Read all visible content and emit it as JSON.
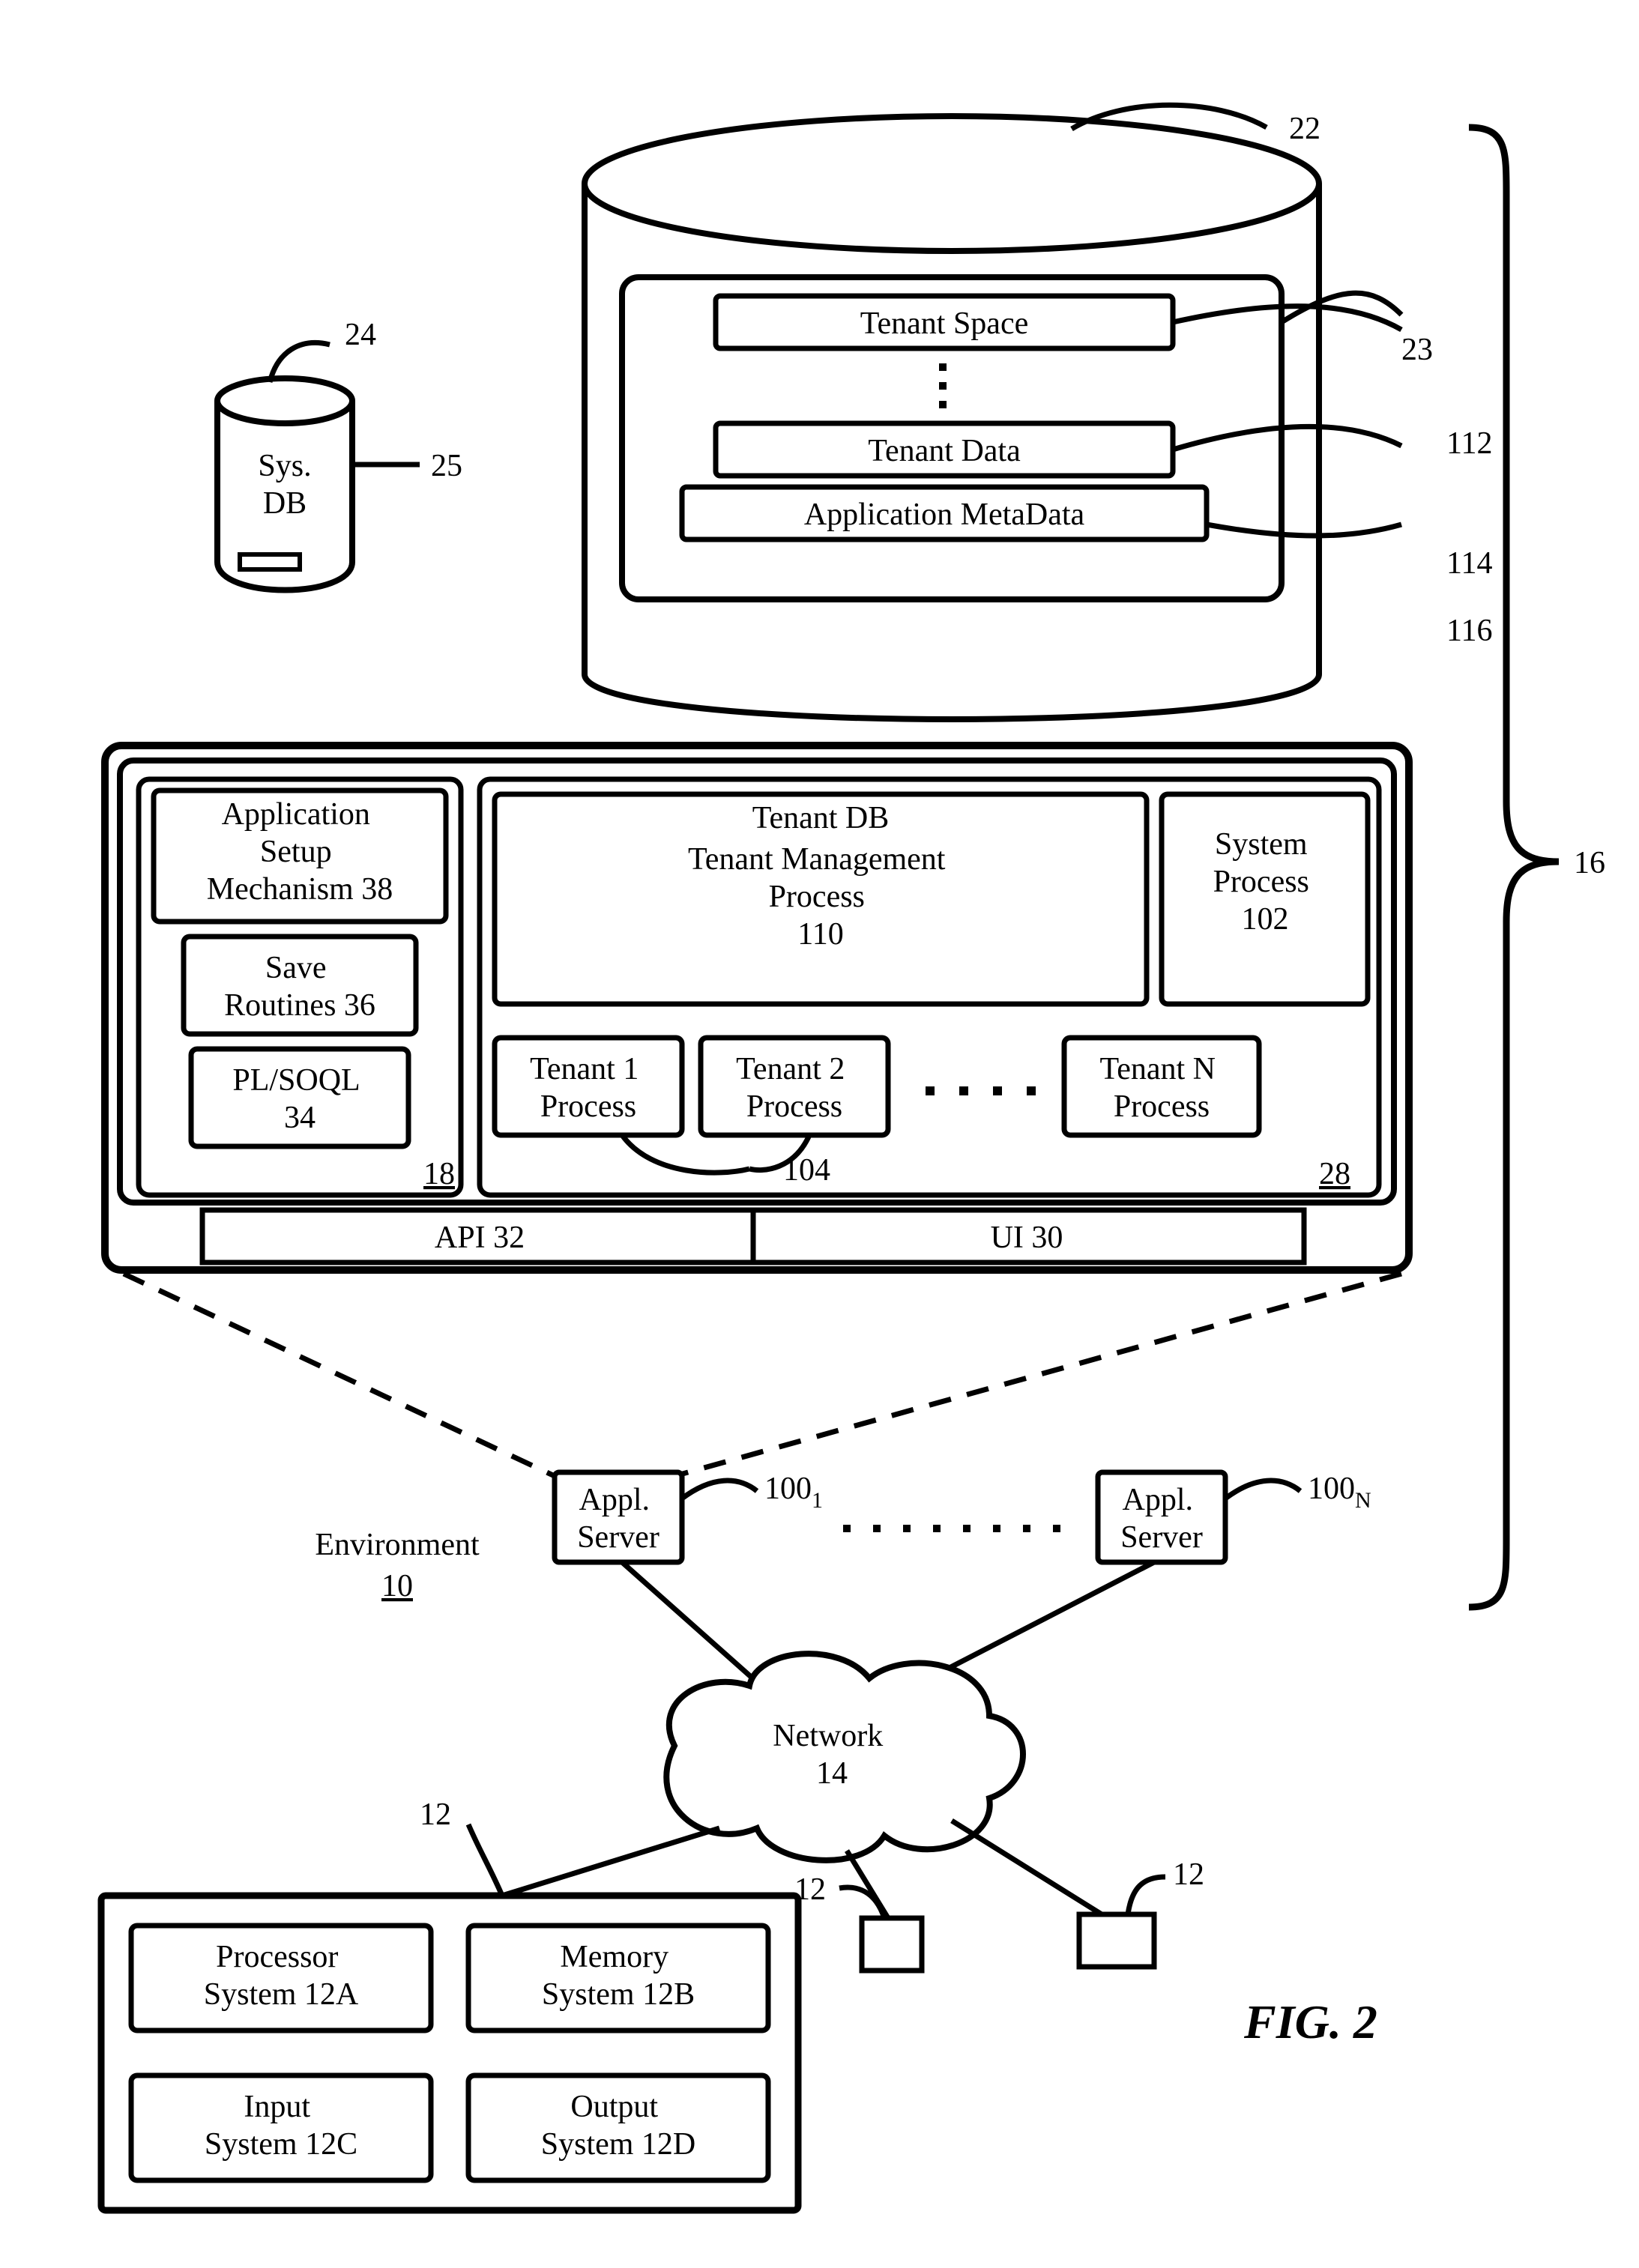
{
  "figure_label": "FIG. 2",
  "tenant_db_outer_ref": "22",
  "sys_db_label": "Sys.\nDB",
  "sys_db_ref_top": "24",
  "sys_db_ref_body": "25",
  "tenant_inner_ref": "23",
  "tenant_space": "Tenant Space",
  "tenant_data": "Tenant Data",
  "app_metadata": "Application MetaData",
  "ref_112": "112",
  "ref_114": "114",
  "ref_116": "116",
  "sys_brace_label": "16",
  "appl_setup": "Application\nSetup\nMechanism 38",
  "save_routines": "Save\nRoutines 36",
  "plsoql": "PL/SOQL\n34",
  "ref_18": "18",
  "tdb_header": "Tenant DB",
  "tmp_text": "Tenant Management\nProcess\n110",
  "sys_proc": "System\nProcess\n102",
  "t1p": "Tenant 1\nProcess",
  "t2p": "Tenant 2\nProcess",
  "tnp": "Tenant N\nProcess",
  "ref_104": "104",
  "ref_28": "28",
  "api_label": "API 32",
  "ui_label": "UI 30",
  "appl_server": "Appl.\nServer",
  "ref_100_1_base": "100",
  "ref_100_1_sub": "1",
  "ref_100_N_base": "100",
  "ref_100_N_sub": "N",
  "env_label": "Environment",
  "env_ref": "10",
  "network_label": "Network\n14",
  "ref_12_left": "12",
  "ref_12_mid": "12",
  "ref_12_right": "12",
  "client_proc": "Processor\nSystem 12A",
  "client_mem": "Memory\nSystem 12B",
  "client_in": "Input\nSystem 12C",
  "client_out": "Output\nSystem 12D"
}
